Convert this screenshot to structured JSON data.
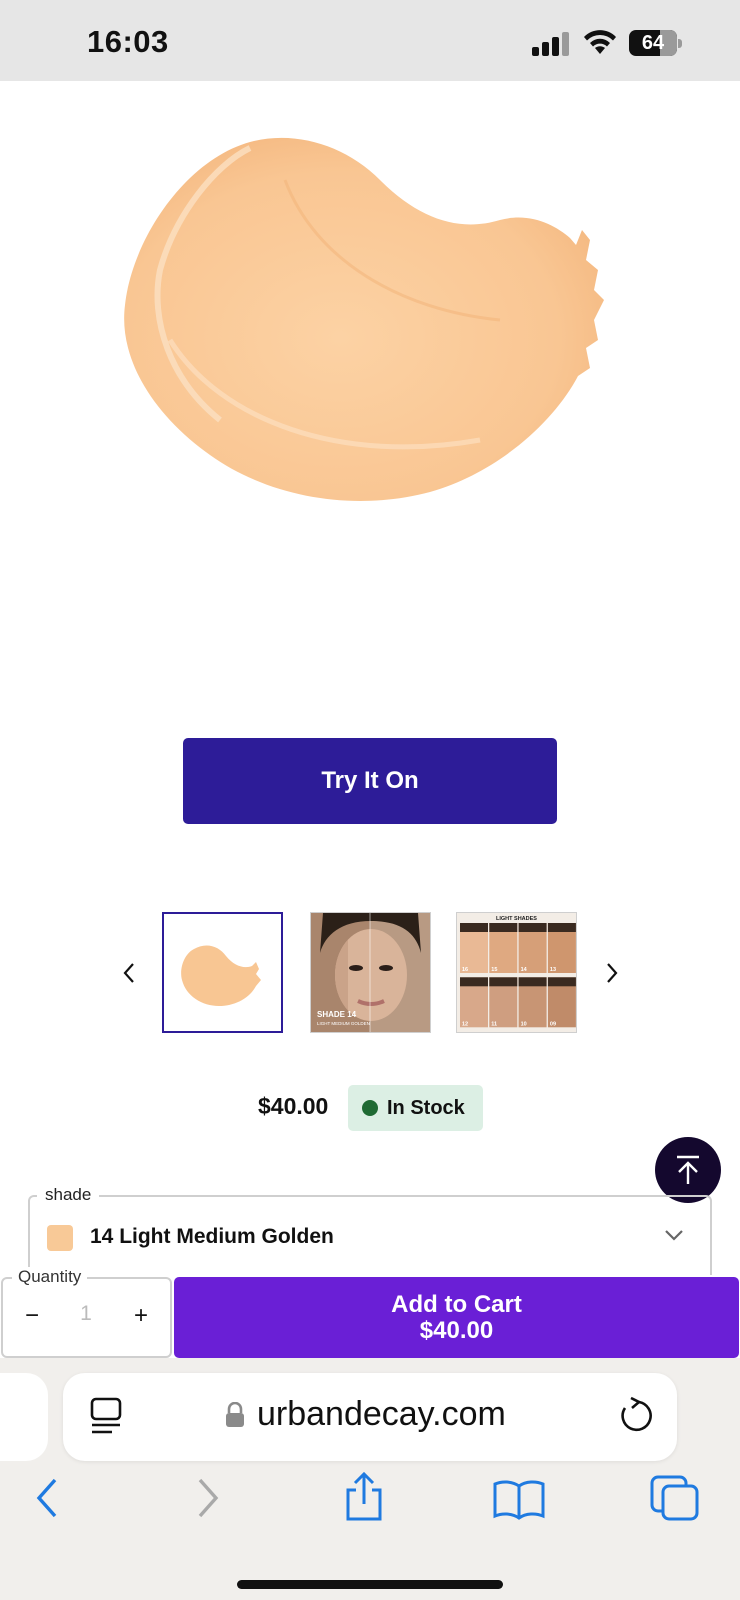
{
  "status_bar": {
    "time": "16:03",
    "battery_percent": "64",
    "battery_level": 0.64
  },
  "product": {
    "swatch_color": "#f8c997",
    "try_on_label": "Try It On",
    "thumbnails": [
      {
        "name": "swatch",
        "selected": true
      },
      {
        "name": "model-face",
        "selected": false
      },
      {
        "name": "light-shades-chart",
        "selected": false
      }
    ],
    "thumb2_caption_1": "SHADE 14",
    "thumb2_caption_2": "LIGHT MEDIUM GOLDEN",
    "thumb3_title": "LIGHT SHADES",
    "thumb3_shades": [
      "16",
      "15",
      "14",
      "13",
      "12",
      "11",
      "10",
      "09"
    ],
    "price": "$40.00",
    "stock_status": "In Stock"
  },
  "shade_select": {
    "legend": "shade",
    "selected": "14 Light Medium Golden"
  },
  "cart": {
    "quantity_legend": "Quantity",
    "minus": "−",
    "quantity": "1",
    "plus": "+",
    "add_label": "Add to Cart",
    "add_price": "$40.00"
  },
  "browser": {
    "url": "urbandecay.com"
  },
  "colors": {
    "brand_indigo": "#2d1c98",
    "cart_purple": "#6a1fd6",
    "stock_green": "#1f6a33",
    "ios_blue": "#1f7ae0"
  }
}
